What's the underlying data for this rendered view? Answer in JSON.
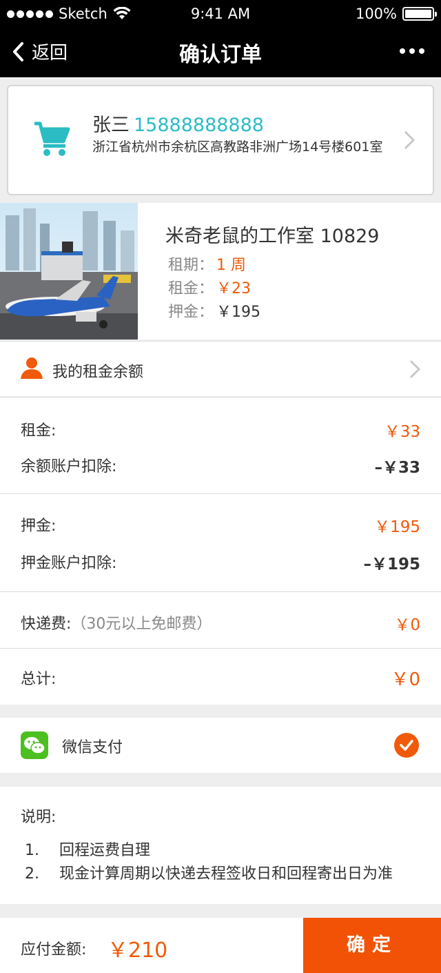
{
  "status_bar": {
    "carrier": "Sketch",
    "time": "9:41 AM",
    "battery": "100%"
  },
  "nav": {
    "back_label": "返回",
    "title": "确认订单"
  },
  "address": {
    "name": "张三",
    "phone": "15888888888",
    "address_line": "浙江省杭州市余杭区高教路非洲广场14号楼601室"
  },
  "product": {
    "name": "米奇老鼠的工作室 10829",
    "rental_period_label": "租期：",
    "rental_period_value": "1 周",
    "rent_label": "租金：",
    "rent_value": "￥23",
    "deposit_label": "押金：",
    "deposit_value": "￥195"
  },
  "balance": {
    "label": "我的租金余额"
  },
  "rent_section": {
    "rent_label": "租金:",
    "rent_value": "￥33",
    "deduct_label": "余额账户扣除:",
    "deduct_value": "–￥33"
  },
  "deposit_section": {
    "deposit_label": "押金:",
    "deposit_value": "￥195",
    "deduct_label": "押金账户扣除:",
    "deduct_value": "–￥195"
  },
  "shipping": {
    "label": "快递费:",
    "note": "（30元以上免邮费）",
    "value": "￥0"
  },
  "total": {
    "label": "总计:",
    "value": "￥0"
  },
  "payment": {
    "method": "微信支付",
    "selected": true
  },
  "notes": {
    "title": "说明:",
    "items": [
      {
        "num": "1.",
        "text": "回程运费自理"
      },
      {
        "num": "2.",
        "text": "现金计算周期以快递去程签收日和回程寄出日为准"
      }
    ]
  },
  "footer": {
    "payable_label": "应付金额:",
    "payable_value": "￥210",
    "confirm_label": "确定"
  },
  "colors": {
    "accent": "#f05a0a",
    "phone": "#2bbcc4",
    "wechat": "#4cc020",
    "navbar": "#000000"
  }
}
